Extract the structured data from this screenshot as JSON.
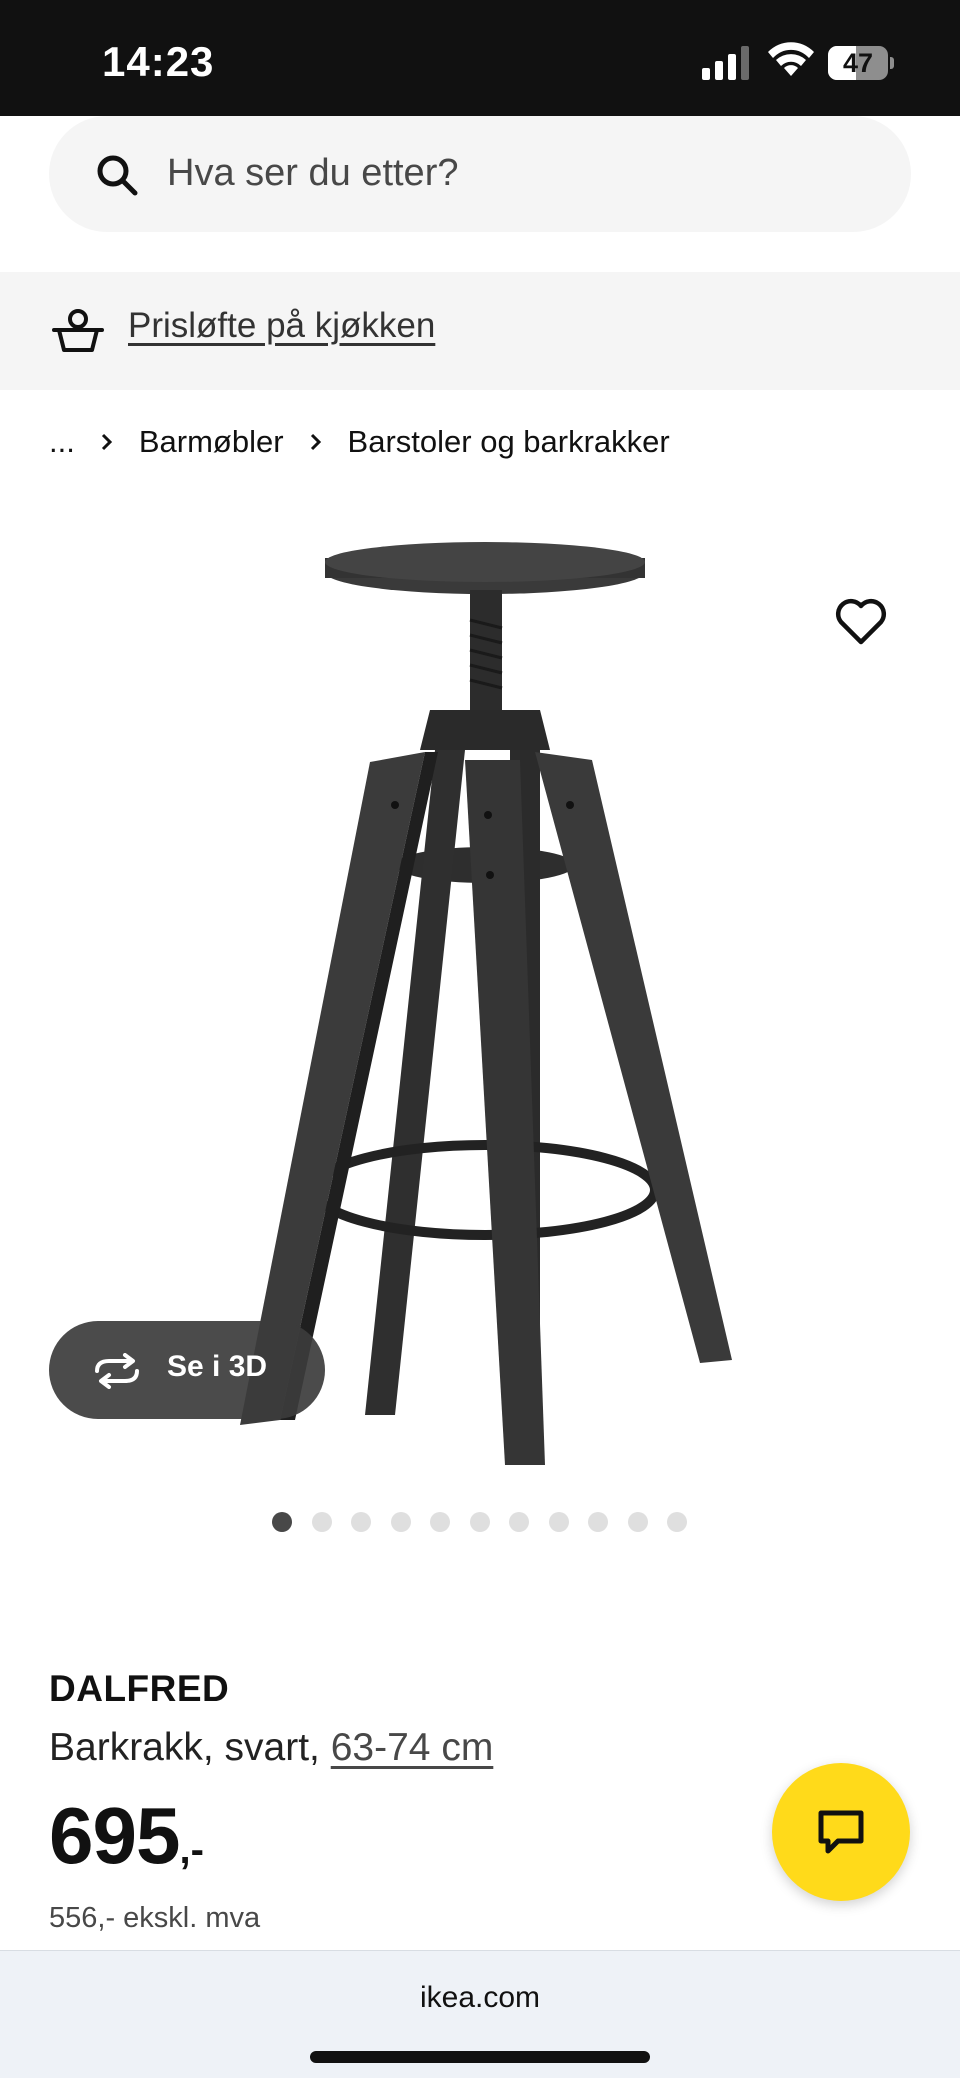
{
  "status_bar": {
    "time": "14:23",
    "battery_level": "47",
    "battery_fraction": 0.47
  },
  "search": {
    "placeholder": "Hva ser du etter?",
    "icon": "search-icon"
  },
  "promo": {
    "icon": "basket-icon",
    "link_text": "Prisløfte på kjøkken"
  },
  "breadcrumb": {
    "items": [
      "...",
      "Barmøbler",
      "Barstoler og barkrakker"
    ]
  },
  "gallery": {
    "image_alt": "DALFRED barkrakk svart",
    "button_3d_label": "Se i 3D",
    "total_images": 11,
    "active_index": 0
  },
  "product": {
    "name": "DALFRED",
    "description": "Barkrakk, svart,",
    "size": "63-74 cm",
    "price_main": "695",
    "price_suffix": ",-",
    "price_ex_vat": "556,- ekskl. mva"
  },
  "browser": {
    "url": "ikea.com"
  },
  "colors": {
    "accent_yellow": "#ffda1a",
    "status_bar": "#111111",
    "panel_gray": "#f5f5f5"
  }
}
